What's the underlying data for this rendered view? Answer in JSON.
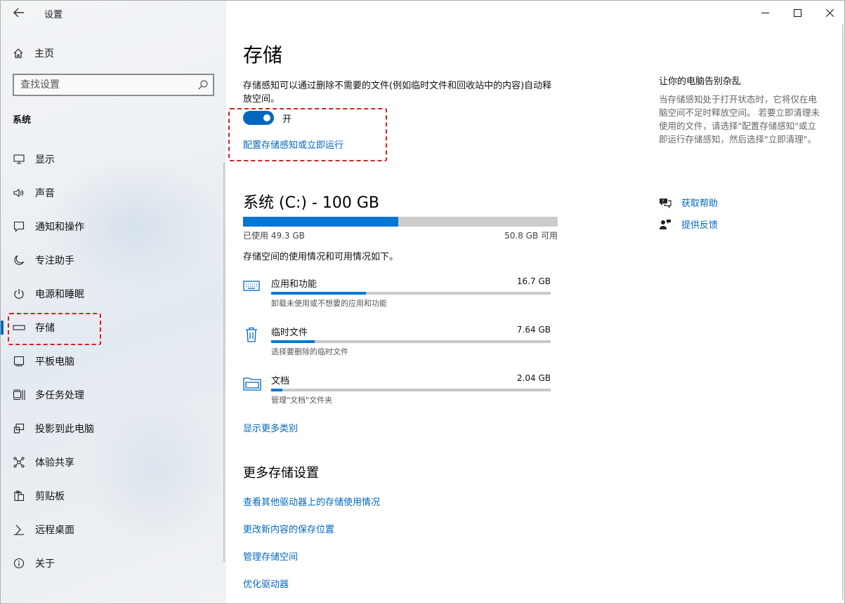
{
  "window": {
    "title": "设置",
    "caption": {
      "minimize": "—",
      "maximize": "☐",
      "close": "✕"
    }
  },
  "sidebar": {
    "home_label": "主页",
    "search_placeholder": "查找设置",
    "section_label": "系统",
    "items": [
      {
        "label": "显示",
        "icon": "display-icon"
      },
      {
        "label": "声音",
        "icon": "speaker-icon"
      },
      {
        "label": "通知和操作",
        "icon": "notification-icon"
      },
      {
        "label": "专注助手",
        "icon": "moon-icon"
      },
      {
        "label": "电源和睡眠",
        "icon": "power-icon"
      },
      {
        "label": "存储",
        "icon": "storage-icon",
        "active": true
      },
      {
        "label": "平板电脑",
        "icon": "tablet-icon"
      },
      {
        "label": "多任务处理",
        "icon": "multitask-icon"
      },
      {
        "label": "投影到此电脑",
        "icon": "project-icon"
      },
      {
        "label": "体验共享",
        "icon": "share-icon"
      },
      {
        "label": "剪贴板",
        "icon": "clipboard-icon"
      },
      {
        "label": "远程桌面",
        "icon": "remote-desktop-icon"
      },
      {
        "label": "关于",
        "icon": "info-icon"
      }
    ]
  },
  "main": {
    "title": "存储",
    "description": "存储感知可以通过删除不需要的文件(例如临时文件和回收站中的内容)自动释放空间。",
    "toggle_state": "开",
    "toggle_on": true,
    "configure_link": "配置存储感知或立即运行",
    "drive": {
      "title": "系统 (C:) - 100 GB",
      "used_label": "已使用 49.3 GB",
      "free_label": "50.8 GB 可用",
      "used_fraction": 0.493
    },
    "usage_desc": "存储空间的使用情况和可用情况如下。",
    "categories": [
      {
        "name": "应用和功能",
        "size": "16.7 GB",
        "desc": "卸载未使用或不想要的应用和功能",
        "fraction": 0.34,
        "icon": "keyboard-icon"
      },
      {
        "name": "临时文件",
        "size": "7.64 GB",
        "desc": "选择要删除的临时文件",
        "fraction": 0.155,
        "icon": "trash-icon"
      },
      {
        "name": "文档",
        "size": "2.04 GB",
        "desc": "管理\"文档\"文件夹",
        "fraction": 0.04,
        "icon": "folder-icon"
      }
    ],
    "more_categories_link": "显示更多类别",
    "more_settings_title": "更多存储设置",
    "more_links": [
      "查看其他驱动器上的存储使用情况",
      "更改新内容的保存位置",
      "管理存储空间",
      "优化驱动器"
    ]
  },
  "right": {
    "title": "让你的电脑告别杂乱",
    "description": "当存储感知处于打开状态时，它将仅在电脑空间不足时释放空间。 若要立即清理未使用的文件，请选择\"配置存储感知\"或立即运行存储感知，然后选择\"立即清理\"。",
    "help_link": "获取帮助",
    "feedback_link": "提供反馈"
  },
  "colors": {
    "accent": "#0067c0",
    "bar_fill": "#0078d4",
    "highlight": "#d91f1f"
  }
}
